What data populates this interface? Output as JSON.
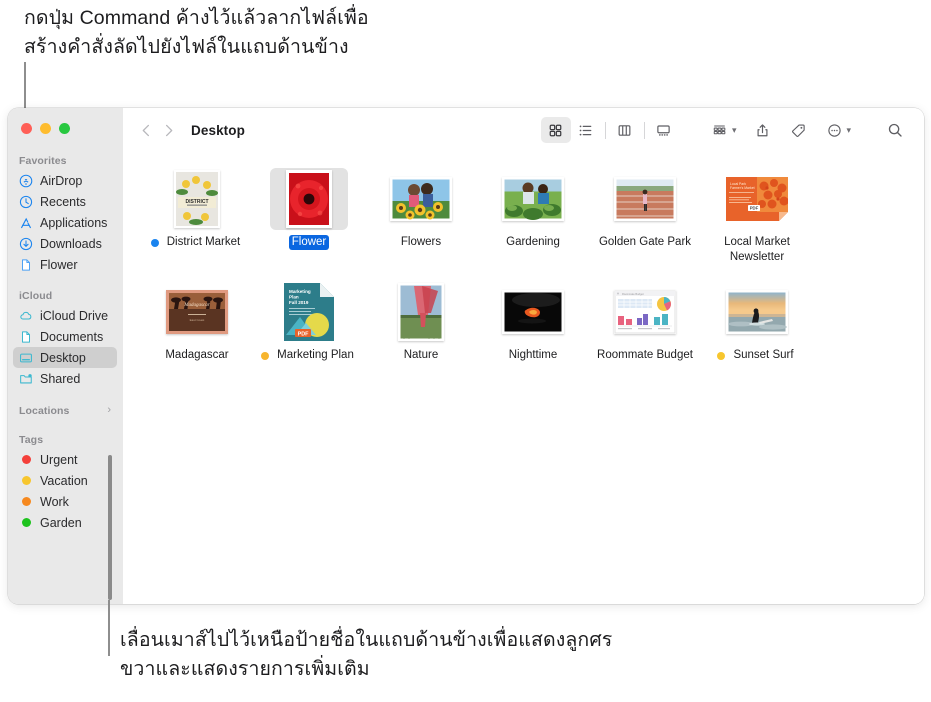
{
  "captions": {
    "top": "กดปุ่ม Command ค้างไว้แล้วลากไฟล์เพื่อ\nสร้างคำสั่งลัดไปยังไฟล์ในแถบด้านข้าง",
    "bottom": "เลื่อนเมาส์ไปไว้เหนือป้ายชื่อในแถบด้านข้างเพื่อแสดงลูกศร\nขวาและแสดงรายการเพิ่มเติม"
  },
  "window": {
    "traffic_lights": [
      "close",
      "minimize",
      "zoom"
    ]
  },
  "toolbar": {
    "back_label": "‹",
    "forward_label": "›",
    "title": "Desktop",
    "view_buttons": [
      {
        "name": "icon-view",
        "label": "Icon View",
        "active": true
      },
      {
        "name": "list-view",
        "label": "List View",
        "active": false
      },
      {
        "name": "column-view",
        "label": "Column View",
        "active": false
      },
      {
        "name": "gallery-view",
        "label": "Gallery View",
        "active": false
      }
    ],
    "action_buttons": [
      {
        "name": "group-by",
        "label": "Group",
        "has_chevron": true
      },
      {
        "name": "share",
        "label": "Share",
        "has_chevron": false
      },
      {
        "name": "tags",
        "label": "Tags",
        "has_chevron": false
      },
      {
        "name": "more-actions",
        "label": "More",
        "has_chevron": true
      },
      {
        "name": "search",
        "label": "Search",
        "has_chevron": false
      }
    ]
  },
  "sidebar": {
    "sections": [
      {
        "title": "Favorites",
        "items": [
          {
            "label": "AirDrop",
            "icon": "airdrop-icon",
            "selected": false
          },
          {
            "label": "Recents",
            "icon": "clock-icon",
            "selected": false
          },
          {
            "label": "Applications",
            "icon": "applications-icon",
            "selected": false
          },
          {
            "label": "Downloads",
            "icon": "download-icon",
            "selected": false
          },
          {
            "label": "Flower",
            "icon": "document-icon",
            "selected": false
          }
        ]
      },
      {
        "title": "iCloud",
        "items": [
          {
            "label": "iCloud Drive",
            "icon": "cloud-icon",
            "selected": false
          },
          {
            "label": "Documents",
            "icon": "document-icon",
            "selected": false
          },
          {
            "label": "Desktop",
            "icon": "desktop-icon",
            "selected": true
          },
          {
            "label": "Shared",
            "icon": "shared-folder-icon",
            "selected": false
          }
        ]
      },
      {
        "title": "Locations",
        "items": [],
        "chevron": "›"
      },
      {
        "title": "Tags",
        "items": [
          {
            "label": "Urgent",
            "color": "#f4403a"
          },
          {
            "label": "Vacation",
            "color": "#f7c62e"
          },
          {
            "label": "Work",
            "color": "#f6891f"
          },
          {
            "label": "Garden",
            "color": "#1ec31e"
          }
        ]
      }
    ]
  },
  "files": [
    {
      "name": "District Market",
      "thumb": "district-market-thumb",
      "kind": "portrait",
      "tag_color": "#1a84ef",
      "selected": false
    },
    {
      "name": "Flower",
      "thumb": "flower-thumb",
      "kind": "portrait",
      "tag_color": null,
      "selected": true
    },
    {
      "name": "Flowers",
      "thumb": "flowers-thumb",
      "kind": "landscape",
      "tag_color": null,
      "selected": false
    },
    {
      "name": "Gardening",
      "thumb": "gardening-thumb",
      "kind": "landscape",
      "tag_color": null,
      "selected": false
    },
    {
      "name": "Golden Gate Park",
      "thumb": "golden-gate-park-thumb",
      "kind": "landscape",
      "tag_color": null,
      "selected": false
    },
    {
      "name": "Local Market Newsletter",
      "thumb": "pdf-newsletter-thumb",
      "kind": "pdf",
      "tag_color": null,
      "selected": false
    },
    {
      "name": "Madagascar",
      "thumb": "madagascar-thumb",
      "kind": "landscape",
      "tag_color": null,
      "selected": false
    },
    {
      "name": "Marketing Plan",
      "thumb": "pdf-marketing-thumb",
      "kind": "pdf2",
      "tag_color": "#f7b52e",
      "selected": false
    },
    {
      "name": "Nature",
      "thumb": "nature-thumb",
      "kind": "portrait",
      "tag_color": null,
      "selected": false
    },
    {
      "name": "Nighttime",
      "thumb": "nighttime-thumb",
      "kind": "landscape",
      "tag_color": null,
      "selected": false
    },
    {
      "name": "Roommate Budget",
      "thumb": "roommate-budget-thumb",
      "kind": "landscape",
      "tag_color": null,
      "selected": false
    },
    {
      "name": "Sunset Surf",
      "thumb": "sunset-surf-thumb",
      "kind": "landscape",
      "tag_color": "#f7c62e",
      "selected": false
    }
  ]
}
